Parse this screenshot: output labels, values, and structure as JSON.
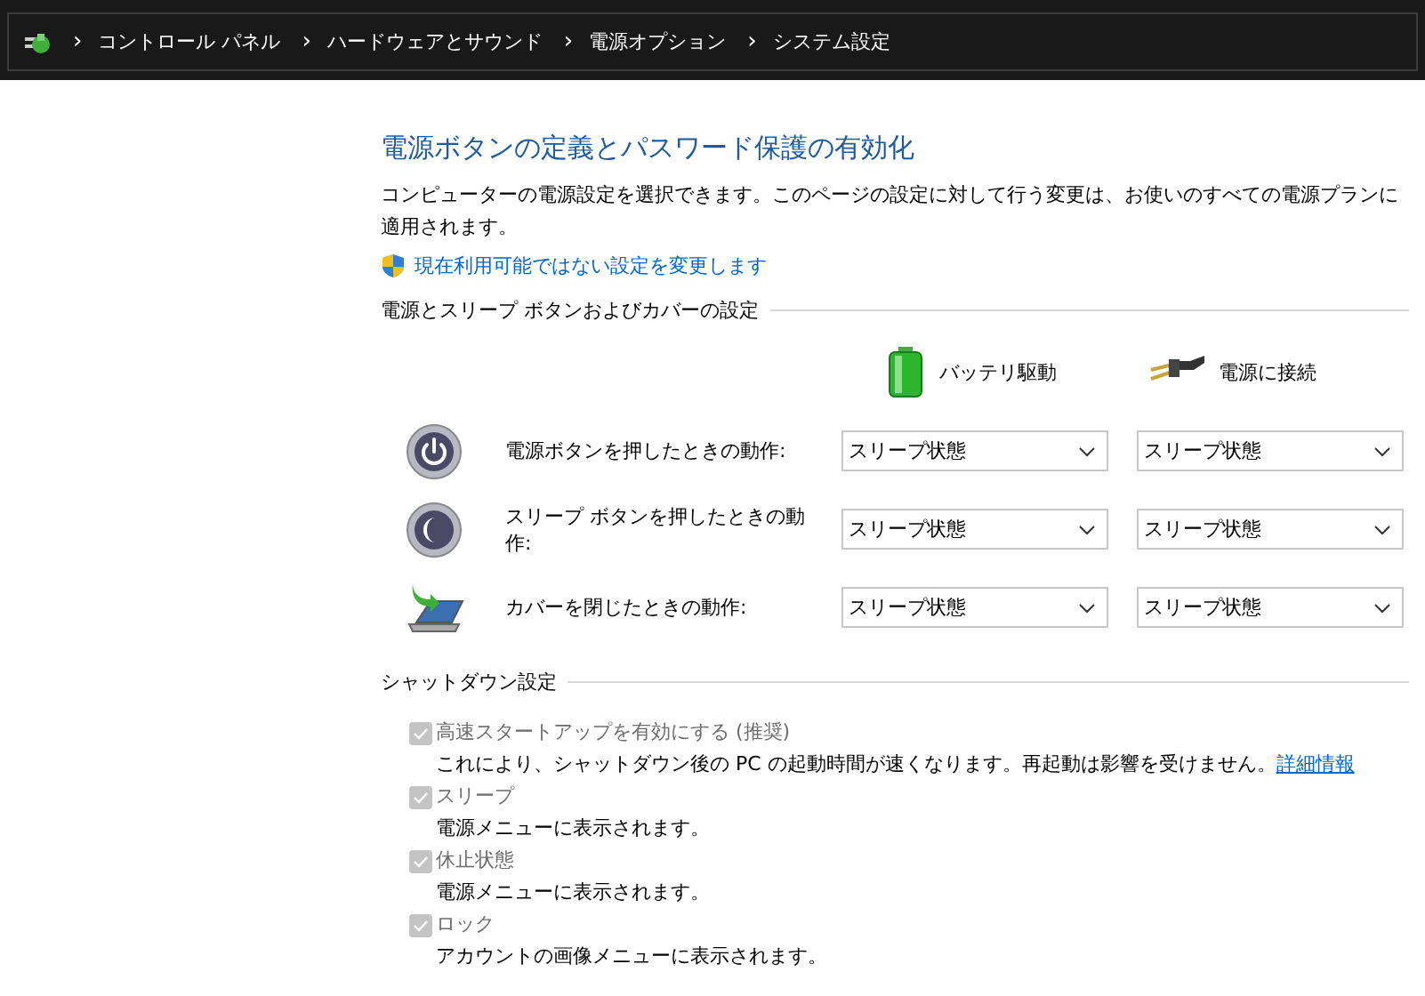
{
  "breadcrumb": {
    "items": [
      {
        "separator": "›",
        "label": "コントロール パネル"
      },
      {
        "separator": "›",
        "label": "ハードウェアとサウンド"
      },
      {
        "separator": "›",
        "label": "電源オプション"
      },
      {
        "separator": "›",
        "label": "システム設定"
      }
    ]
  },
  "title": "電源ボタンの定義とパスワード保護の有効化",
  "description": "コンピューターの電源設定を選択できます。このページの設定に対して行う変更は、お使いのすべての電源プランに適用されます。",
  "admin_link": "現在利用可能ではない設定を変更します",
  "power_section": {
    "heading": "電源とスリープ ボタンおよびカバーの設定",
    "columns": [
      {
        "kind": "battery",
        "label": "バッテリ駆動"
      },
      {
        "kind": "plug",
        "label": "電源に接続"
      }
    ],
    "rows": [
      {
        "kind": "power",
        "label": "電源ボタンを押したときの動作:",
        "values": [
          "スリープ状態",
          "スリープ状態"
        ]
      },
      {
        "kind": "sleep",
        "label": "スリープ ボタンを押したときの動作:",
        "values": [
          "スリープ状態",
          "スリープ状態"
        ]
      },
      {
        "kind": "lid",
        "label": "カバーを閉じたときの動作:",
        "values": [
          "スリープ状態",
          "スリープ状態"
        ]
      }
    ]
  },
  "shutdown_section": {
    "heading": "シャットダウン設定",
    "options": [
      {
        "label": "高速スタートアップを有効にする (推奨)",
        "checked": true,
        "disabled": true,
        "description": "これにより、シャットダウン後の PC の起動時間が速くなります。再起動は影響を受けません。",
        "link": "詳細情報"
      },
      {
        "label": "スリープ",
        "checked": true,
        "disabled": true,
        "description": "電源メニューに表示されます。"
      },
      {
        "label": "休止状態",
        "checked": true,
        "disabled": true,
        "description": "電源メニューに表示されます。"
      },
      {
        "label": "ロック",
        "checked": true,
        "disabled": true,
        "description": "アカウントの画像メニューに表示されます。"
      }
    ]
  }
}
